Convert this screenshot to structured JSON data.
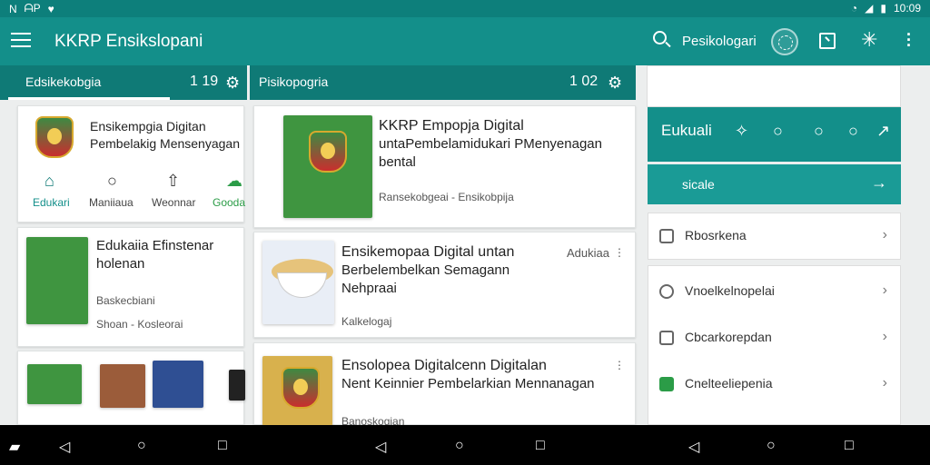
{
  "status": {
    "left_icons": [
      "N",
      "ᗩP",
      "♥"
    ],
    "right_time": "10:09"
  },
  "app": {
    "title": "KKRP Ensikslopani",
    "search_label": "Pesikologari"
  },
  "tabs": [
    {
      "label": "Edsikekobgia",
      "count": "1 19"
    },
    {
      "label": "Pisikopogria",
      "count": "1 02"
    }
  ],
  "left_cards": [
    {
      "title": "Ensikempgia Digitan",
      "subtitle": "Pembelakig Mensenyagan"
    },
    {
      "title": "Edukaiia Efinstenar",
      "subtitle": "holenan",
      "meta1": "Baskecbiani",
      "meta2": "Shoan - Kosleorai"
    }
  ],
  "bottom_items": [
    "Edukari",
    "Maniiaua",
    "Weonnar",
    "Gooda"
  ],
  "middle_cards": [
    {
      "title": "KKRP Empopja Digital",
      "subtitle": "untaPembelamidukari PMenyenagan",
      "third": "bental",
      "meta": "Ransekobgeai - Ensikobpija"
    },
    {
      "title": "Ensikemopaa Digital untan",
      "subtitle": "Berbelembelkan Semagann",
      "third": "Nehpraai",
      "tag": "Adukiaa",
      "meta": "Kalkelogaj"
    },
    {
      "title": "Ensolopea Digitalcenn Digitalan",
      "subtitle": "Nent Keinnier Pembelarkian Mennanagan",
      "meta": "Banoskogian"
    }
  ],
  "right": {
    "banner": "Eukuali",
    "button": "sicale",
    "list_single": "Rbosrkena",
    "list_items": [
      "Vnoelkelnopelai",
      "Cbcarkorepdan",
      "Cnelteeliepenia"
    ]
  }
}
